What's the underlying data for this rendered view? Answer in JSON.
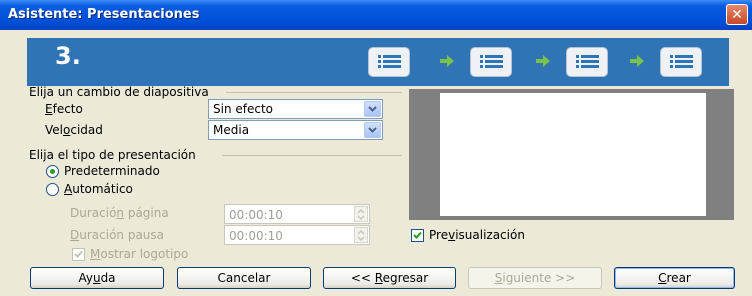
{
  "window": {
    "title": "Asistente: Presentaciones",
    "close_glyph": "✕"
  },
  "banner": {
    "step": "3.",
    "icons": [
      "list-icon",
      "list-icon",
      "list-icon",
      "list-icon"
    ],
    "arrow_icon": "right-arrow-icon"
  },
  "transition": {
    "section_label": "Elija un cambio de diapositiva",
    "effect_label_pre": "",
    "effect_label_acc": "E",
    "effect_label_post": "fecto",
    "effect_value": "Sin efecto",
    "speed_label_pre": "Vel",
    "speed_label_acc": "o",
    "speed_label_post": "cidad",
    "speed_value": "Media"
  },
  "presentation": {
    "section_label": "Elija el tipo de presentación",
    "default_label": "Predeterminado",
    "auto_label_pre": "",
    "auto_label_acc": "A",
    "auto_label_post": "utomático",
    "page_duration_pre": "Duració",
    "page_duration_acc": "n",
    "page_duration_post": " página",
    "page_duration_value": "00:00:10",
    "pause_duration_pre": "",
    "pause_duration_acc": "D",
    "pause_duration_post": "uración pausa",
    "pause_duration_value": "00:00:10",
    "show_logo_pre": "",
    "show_logo_acc": "M",
    "show_logo_post": "ostrar logotipo"
  },
  "preview_check": {
    "pre": "Pre",
    "acc": "v",
    "post": "isualización"
  },
  "buttons": {
    "help": {
      "pre": "Ay",
      "acc": "u",
      "post": "da"
    },
    "cancel": "Cancelar",
    "back": {
      "pre": "<< ",
      "acc": "R",
      "post": "egresar"
    },
    "next": {
      "pre": "",
      "acc": "S",
      "post": "iguiente >>"
    },
    "create": {
      "pre": "",
      "acc": "C",
      "post": "rear"
    }
  },
  "colors": {
    "title_bar": "#0050d8",
    "banner": "#2f75b5",
    "accent_green": "#21a121"
  }
}
